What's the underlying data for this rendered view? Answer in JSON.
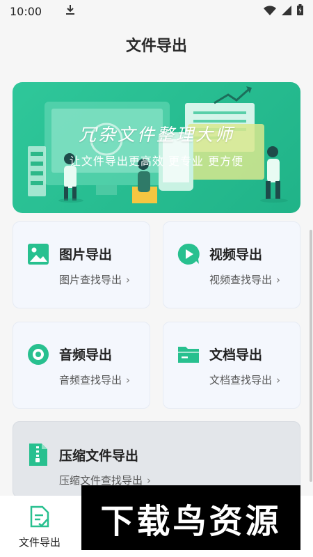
{
  "status_bar": {
    "time": "10:00"
  },
  "header": {
    "title": "文件导出"
  },
  "banner": {
    "title": "冗杂文件整理大师",
    "subtitle": "让文件导出更高效 更专业 更方便"
  },
  "cards": [
    {
      "title": "图片导出",
      "subtitle": "图片查找导出",
      "icon": "image-icon"
    },
    {
      "title": "视频导出",
      "subtitle": "视频查找导出",
      "icon": "video-play-icon"
    },
    {
      "title": "音频导出",
      "subtitle": "音频查找导出",
      "icon": "audio-disc-icon"
    },
    {
      "title": "文档导出",
      "subtitle": "文档查找导出",
      "icon": "folder-icon"
    },
    {
      "title": "压缩文件导出",
      "subtitle": "压缩文件查找导出",
      "icon": "zip-file-icon"
    }
  ],
  "chevron": "›",
  "bottom_nav": {
    "items": [
      {
        "label": "文件导出",
        "icon": "file-export-icon"
      }
    ]
  },
  "watermark": "下载鸟资源",
  "colors": {
    "accent": "#28c08f",
    "banner": "#2cc497",
    "card_bg": "#f4f7fd"
  }
}
